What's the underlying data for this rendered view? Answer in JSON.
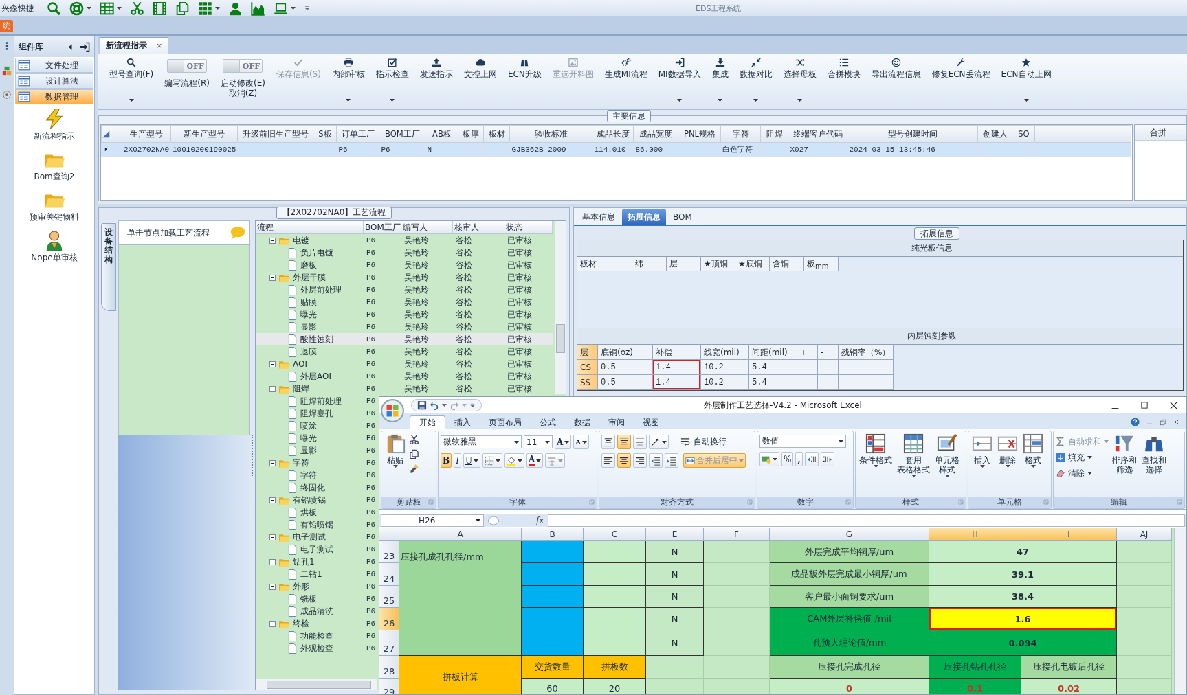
{
  "quick_access": {
    "label": "兴森快捷",
    "tools": [
      {
        "dropdown": false
      },
      {
        "dropdown": true
      },
      {
        "dropdown": true
      },
      {
        "dropdown": false
      },
      {
        "dropdown": false
      },
      {
        "dropdown": false
      },
      {
        "dropdown": true
      },
      {
        "dropdown": false
      },
      {
        "dropdown": false
      },
      {
        "dropdown": true
      }
    ]
  },
  "app": {
    "title": "EDS工程系统",
    "menu_tab": "统"
  },
  "sidebar": {
    "title": "组件库",
    "items": [
      {
        "label": "文件处理",
        "selected": false
      },
      {
        "label": "设计算法",
        "selected": false
      },
      {
        "label": "数据管理",
        "selected": true
      }
    ],
    "tiles": [
      "新流程指示",
      "Bom查询2",
      "预审关键物料",
      "Nope单审核"
    ]
  },
  "document_tab": {
    "label": "新流程指示",
    "close": "×"
  },
  "ribbon": [
    {
      "kind": "button",
      "label": "型号查询(F)",
      "dropdown": true,
      "disabled": false
    },
    {
      "kind": "toggle",
      "label": "编写流程(R)",
      "state": "OFF",
      "on": false
    },
    {
      "kind": "toggle",
      "label": "启动修改(E)\n取消(Z)",
      "state": "OFF",
      "on": false
    },
    {
      "kind": "button",
      "label": "保存信息(S)",
      "dropdown": false,
      "disabled": true
    },
    {
      "kind": "button",
      "label": "内部审核",
      "dropdown": true,
      "disabled": false
    },
    {
      "kind": "button",
      "label": "指示检查",
      "dropdown": true,
      "disabled": false
    },
    {
      "kind": "button",
      "label": "发送指示",
      "dropdown": false,
      "disabled": false
    },
    {
      "kind": "button",
      "label": "文控上网",
      "dropdown": false,
      "disabled": false
    },
    {
      "kind": "button",
      "label": "ECN升级",
      "dropdown": false,
      "disabled": false
    },
    {
      "kind": "button",
      "label": "重选开料图",
      "dropdown": false,
      "disabled": true
    },
    {
      "kind": "button",
      "label": "生成MI流程",
      "dropdown": false,
      "disabled": false
    },
    {
      "kind": "button",
      "label": "MI数据导入",
      "dropdown": true,
      "disabled": false
    },
    {
      "kind": "button",
      "label": "集成",
      "dropdown": true,
      "disabled": false
    },
    {
      "kind": "button",
      "label": "数据对比",
      "dropdown": true,
      "disabled": false
    },
    {
      "kind": "button",
      "label": "选择母板",
      "dropdown": true,
      "disabled": false
    },
    {
      "kind": "button",
      "label": "合拼模块",
      "dropdown": false,
      "disabled": false
    },
    {
      "kind": "button",
      "label": "导出流程信息",
      "dropdown": false,
      "disabled": false
    },
    {
      "kind": "button",
      "label": "修复ECN丢流程",
      "dropdown": false,
      "disabled": false
    },
    {
      "kind": "button",
      "label": "ECN自动上网",
      "dropdown": true,
      "disabled": false
    }
  ],
  "main_info": {
    "title": "主要信息",
    "columns": [
      "生产型号",
      "新生产型号",
      "升级前旧生产型号",
      "S板",
      "订单工厂",
      "BOM工厂",
      "AB板",
      "板厚",
      "板材",
      "验收标准",
      "成品长度",
      "成品宽度",
      "PNL规格",
      "字符",
      "阻焊",
      "终端客户代码",
      "型号创建时间",
      "创建人",
      "SO"
    ],
    "rows": [
      {
        "selected": true,
        "cells": [
          "2X02702NA0",
          "10010200190025",
          null,
          null,
          "P6",
          "P6",
          "N",
          null,
          null,
          "GJB362B-2009",
          "114.010",
          "86.000",
          null,
          "白色字符",
          null,
          "X027",
          "2024-03-15 13:45:46",
          null,
          null
        ]
      }
    ],
    "side_panel": "合拼"
  },
  "process": {
    "title": "【2X02702NA0】工艺流程",
    "side_tab": "设备结构",
    "hint": "单击节点加载工艺流程",
    "columns": [
      "流程",
      "BOM工厂",
      "编写人",
      "核审人",
      "状态"
    ],
    "tree": [
      {
        "name": "电镀",
        "bom": "P6",
        "writer": "吴艳玲",
        "reviewer": "谷松",
        "status": "已审核",
        "expanded": true,
        "selected": false,
        "children": [
          {
            "name": "负片电镀",
            "bom": "P6",
            "writer": "吴艳玲",
            "reviewer": "谷松",
            "status": "已审核",
            "selected": false
          },
          {
            "name": "磨板",
            "bom": "P6",
            "writer": "吴艳玲",
            "reviewer": "谷松",
            "status": "已审核",
            "selected": false
          }
        ]
      },
      {
        "name": "外层干膜",
        "bom": "P6",
        "writer": "吴艳玲",
        "reviewer": "谷松",
        "status": "已审核",
        "expanded": true,
        "selected": false,
        "children": [
          {
            "name": "外层前处理",
            "bom": "P6",
            "writer": "吴艳玲",
            "reviewer": "谷松",
            "status": "已审核",
            "selected": false
          },
          {
            "name": "贴膜",
            "bom": "P6",
            "writer": "吴艳玲",
            "reviewer": "谷松",
            "status": "已审核",
            "selected": false
          },
          {
            "name": "曝光",
            "bom": "P6",
            "writer": "吴艳玲",
            "reviewer": "谷松",
            "status": "已审核",
            "selected": false
          },
          {
            "name": "显影",
            "bom": "P6",
            "writer": "吴艳玲",
            "reviewer": "谷松",
            "status": "已审核",
            "selected": false
          },
          {
            "name": "酸性蚀刻",
            "bom": "P6",
            "writer": "吴艳玲",
            "reviewer": "谷松",
            "status": "已审核",
            "selected": true
          },
          {
            "name": "退膜",
            "bom": "P6",
            "writer": "吴艳玲",
            "reviewer": "谷松",
            "status": "已审核",
            "selected": false
          }
        ]
      },
      {
        "name": "AOI",
        "bom": "P6",
        "writer": "吴艳玲",
        "reviewer": "谷松",
        "status": "已审核",
        "expanded": true,
        "selected": false,
        "children": [
          {
            "name": "外层AOI",
            "bom": "P6",
            "writer": "吴艳玲",
            "reviewer": "谷松",
            "status": "已审核",
            "selected": false
          }
        ]
      },
      {
        "name": "阻焊",
        "bom": "P6",
        "writer": "吴艳玲",
        "reviewer": "谷松",
        "status": "已审核",
        "expanded": true,
        "selected": false,
        "children": [
          {
            "name": "阻焊前处理",
            "bom": "P6",
            "selected": false
          },
          {
            "name": "阻焊塞孔",
            "bom": "P6",
            "selected": false
          },
          {
            "name": "喷涂",
            "bom": "P6",
            "selected": false
          },
          {
            "name": "曝光",
            "bom": "P6",
            "selected": false
          },
          {
            "name": "显影",
            "bom": "P6",
            "selected": false
          }
        ]
      },
      {
        "name": "字符",
        "bom": "P6",
        "expanded": true,
        "selected": false,
        "children": [
          {
            "name": "字符",
            "bom": "P6",
            "selected": false
          },
          {
            "name": "终固化",
            "bom": "P6",
            "selected": false
          }
        ]
      },
      {
        "name": "有铅喷锡",
        "bom": "P6",
        "expanded": true,
        "selected": false,
        "children": [
          {
            "name": "烘板",
            "bom": "P6",
            "selected": false
          },
          {
            "name": "有铅喷锡",
            "bom": "P6",
            "selected": false
          }
        ]
      },
      {
        "name": "电子测试",
        "bom": "P6",
        "expanded": true,
        "selected": false,
        "children": [
          {
            "name": "电子测试",
            "bom": "P6",
            "selected": false
          }
        ]
      },
      {
        "name": "钻孔1",
        "bom": "P6",
        "expanded": true,
        "selected": false,
        "children": [
          {
            "name": "二钻1",
            "bom": "P6",
            "selected": false
          }
        ]
      },
      {
        "name": "外形",
        "bom": "P6",
        "expanded": true,
        "selected": false,
        "children": [
          {
            "name": "铣板",
            "bom": "P6",
            "selected": false
          },
          {
            "name": "成品清洗",
            "bom": "P6",
            "selected": false
          }
        ]
      },
      {
        "name": "终检",
        "bom": "P6",
        "expanded": true,
        "selected": false,
        "children": [
          {
            "name": "功能检查",
            "bom": "P6",
            "selected": false
          },
          {
            "name": "外观检查",
            "bom": "P6",
            "selected": false
          }
        ]
      }
    ]
  },
  "extension": {
    "tabs": [
      {
        "label": "基本信息",
        "selected": false
      },
      {
        "label": "拓展信息",
        "selected": true
      },
      {
        "label": "BOM",
        "selected": false
      }
    ],
    "title": "拓展信息",
    "plain_board": {
      "title": "纯光板信息",
      "columns": [
        "板材",
        "纬",
        "层",
        "★顶铜",
        "★底铜",
        "含铜",
        "板$_{mm}$"
      ]
    },
    "etch": {
      "title": "内层蚀刻参数",
      "columns": [
        {
          "label": "层",
          "marked": false
        },
        {
          "label": "底铜(oz)",
          "marked": false
        },
        {
          "label": "补偿",
          "marked": true
        },
        {
          "label": "线宽(mil)",
          "marked": false
        },
        {
          "label": "间距(mil)",
          "marked": false
        },
        {
          "label": "+",
          "marked": false
        },
        {
          "label": "-",
          "marked": false
        },
        {
          "label": "残铜率（%）",
          "marked": false
        }
      ],
      "rows": [
        {
          "cells": [
            "CS",
            "0.5",
            "1.4",
            "10.2",
            "5.4",
            null,
            null,
            null
          ]
        },
        {
          "cells": [
            "SS",
            "0.5",
            "1.4",
            "10.2",
            "5.4",
            null,
            null,
            null
          ]
        }
      ]
    }
  },
  "excel": {
    "title": "外层制作工艺选择-V4.2 - Microsoft Excel",
    "tabs": [
      {
        "label": "开始",
        "selected": true
      },
      {
        "label": "插入",
        "selected": false
      },
      {
        "label": "页面布局",
        "selected": false
      },
      {
        "label": "公式",
        "selected": false
      },
      {
        "label": "数据",
        "selected": false
      },
      {
        "label": "审阅",
        "selected": false
      },
      {
        "label": "视图",
        "selected": false
      }
    ],
    "clipboard": {
      "title": "剪贴板",
      "paste": "粘贴"
    },
    "font": {
      "title": "字体",
      "name": "微软雅黑",
      "size": "11",
      "grow": "A",
      "shrink": "A",
      "bold": "B",
      "italic": "I",
      "underline": "U",
      "font_color_button": "A"
    },
    "alignment": {
      "title": "对齐方式",
      "wrap": "自动换行",
      "merge": "合并后居中",
      "merge_on": true,
      "align": [
        {
          "on": false
        },
        {
          "on": true
        },
        {
          "on": false
        },
        {
          "on": false
        },
        {
          "on": true
        },
        {
          "on": false
        }
      ]
    },
    "number": {
      "title": "数字",
      "format": "数值",
      "percent": "%",
      "comma": ","
    },
    "styles": {
      "title": "样式",
      "buttons": [
        [
          "条件格式"
        ],
        [
          "套用",
          "表格格式"
        ],
        [
          "单元格",
          "样式"
        ]
      ]
    },
    "cells_group": {
      "title": "单元格",
      "buttons": [
        "插入",
        "删除",
        "格式"
      ]
    },
    "editing": {
      "title": "编辑",
      "small": [
        {
          "label": "自动求和",
          "disabled": true
        },
        {
          "label": "填充",
          "disabled": false
        },
        {
          "label": "清除",
          "disabled": false
        }
      ],
      "buttons": [
        [
          "排序和",
          "筛选"
        ],
        [
          "查找和",
          "选择"
        ]
      ]
    },
    "name_box": "H26",
    "fx": "fx",
    "columns": [
      {
        "label": "A",
        "selected": false
      },
      {
        "label": "B",
        "selected": false
      },
      {
        "label": "C",
        "selected": false
      },
      {
        "label": "E",
        "selected": false
      },
      {
        "label": "F",
        "selected": false
      },
      {
        "label": "G",
        "selected": false
      },
      {
        "label": "H",
        "selected": true
      },
      {
        "label": "I",
        "selected": true
      },
      {
        "label": "AJ",
        "selected": false
      }
    ],
    "rows": [
      {
        "label": "23",
        "selected": false,
        "cells": [
          {
            "text": "压接孔成孔孔径/mm",
            "color": "#9cd79a",
            "kind": "title",
            "marked": false
          },
          {
            "color": "#00b0f0",
            "kind": "fill",
            "marked": false
          },
          {
            "color": "#c6eec6",
            "kind": "fill",
            "marked": false
          },
          {
            "text": "N",
            "kind": "label",
            "marked": false
          },
          null,
          {
            "text": "外层完成平均铜厚/um",
            "color": "#a5dba0",
            "kind": "label",
            "marked": false
          },
          {
            "text": "47",
            "color": "#c6eec6",
            "kind": "value",
            "marked": false
          },
          {
            "joins_left": true
          },
          null
        ]
      },
      {
        "label": "24",
        "selected": false,
        "cells": [
          {
            "joins_up": true
          },
          {
            "color": "#00b0f0",
            "kind": "fill",
            "marked": false
          },
          {
            "color": "#c6eec6",
            "kind": "fill",
            "marked": false
          },
          {
            "text": "N",
            "kind": "label",
            "marked": false
          },
          null,
          {
            "text": "成品板外层完成最小铜厚/um",
            "color": "#a5dba0",
            "kind": "label",
            "marked": false
          },
          {
            "text": "39.1",
            "color": "#c6eec6",
            "kind": "value",
            "marked": false
          },
          {
            "joins_left": true
          },
          null
        ]
      },
      {
        "label": "25",
        "selected": false,
        "cells": [
          {
            "joins_up": true
          },
          {
            "color": "#00b0f0",
            "kind": "fill",
            "marked": false
          },
          {
            "color": "#c6eec6",
            "kind": "fill",
            "marked": false
          },
          {
            "text": "N",
            "kind": "label",
            "marked": false
          },
          null,
          {
            "text": "客户最小面铜要求/um",
            "color": "#a5dba0",
            "kind": "label",
            "marked": false
          },
          {
            "text": "38.4",
            "color": "#c6eec6",
            "kind": "value",
            "marked": false
          },
          {
            "joins_left": true
          },
          null
        ]
      },
      {
        "label": "26",
        "selected": true,
        "cells": [
          {
            "joins_up": true
          },
          {
            "color": "#00b0f0",
            "kind": "fill",
            "marked": false
          },
          {
            "color": "#c6eec6",
            "kind": "fill",
            "marked": false
          },
          {
            "text": "N",
            "kind": "label",
            "marked": false
          },
          null,
          {
            "text": "CAM外层补偿值 /mil",
            "color": "#00b050",
            "kind": "label",
            "marked": false
          },
          {
            "text": "1.6",
            "color": "#ffff00",
            "kind": "value",
            "marked": true
          },
          {
            "joins_left": true
          },
          null
        ]
      },
      {
        "label": "27",
        "selected": false,
        "cells": [
          {
            "joins_up": true
          },
          {
            "color": "#00b0f0",
            "kind": "fill",
            "marked": false
          },
          {
            "color": "#c6eec6",
            "kind": "fill",
            "marked": false
          },
          {
            "text": "N",
            "kind": "label",
            "marked": false
          },
          null,
          {
            "text": "孔预大理论值/mm",
            "color": "#00b050",
            "kind": "label",
            "marked": false
          },
          {
            "text": "0.094",
            "color": "#00b050",
            "kind": "value",
            "marked": false
          },
          {
            "joins_left": true
          },
          null
        ]
      },
      {
        "label": "28",
        "selected": false,
        "cells": [
          {
            "text": "拼板计算",
            "color": "#ffc000",
            "kind": "label",
            "marked": false
          },
          {
            "text": "交货数量",
            "color": "#ffc000",
            "kind": "label",
            "marked": false
          },
          {
            "text": "拼板数",
            "color": "#ffc000",
            "kind": "label",
            "marked": false
          },
          null,
          null,
          {
            "text": "压接孔完成孔径",
            "color": "#a5dba0",
            "kind": "label",
            "marked": false
          },
          {
            "text": "压接孔钻孔孔径",
            "color": "#00b050",
            "kind": "label",
            "marked": false
          },
          {
            "text": "压接孔电镀后孔径",
            "color": "#a5dba0",
            "kind": "label",
            "marked": false
          },
          null
        ]
      },
      {
        "label": "29",
        "selected": false,
        "cells": [
          {
            "joins_up": true
          },
          {
            "text": "60",
            "color": "#c6eec6",
            "kind": "label",
            "marked": false
          },
          {
            "text": "20",
            "color": "#c6eec6",
            "kind": "label",
            "marked": false
          },
          null,
          null,
          {
            "text": "0",
            "color": "#c6eec6",
            "kind": "alert",
            "marked": false
          },
          {
            "text": "0.1",
            "color": "#00b050",
            "kind": "alert",
            "marked": false
          },
          {
            "text": "0.02",
            "color": "#c6eec6",
            "kind": "alert",
            "marked": false
          },
          null
        ]
      }
    ]
  }
}
